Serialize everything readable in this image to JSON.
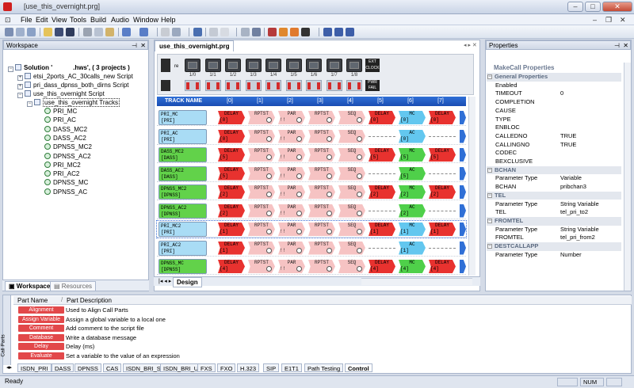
{
  "window": {
    "title": "[use_this_overnight.prg]",
    "controls": [
      "–",
      "□",
      "✕"
    ]
  },
  "menu": [
    "File",
    "Edit",
    "View",
    "Tools",
    "Build",
    "Audio",
    "Window",
    "Help"
  ],
  "workspace": {
    "title": "Workspace",
    "solution": "Solution '",
    "solution_rest": ".hws', ( 3 projects )",
    "projects": [
      "etsi_2ports_AC_30calls_new Script",
      "pri_dass_dpnss_both_dirns Script",
      "use_this_overnight Script"
    ],
    "tracks_node": "use_this_overnight Tracks",
    "tracks": [
      "PRI_MC",
      "PRI_AC",
      "DASS_MC2",
      "DASS_AC2",
      "DPNSS_MC2",
      "DPNSS_AC2",
      "PRI_MC2",
      "PRI_AC2",
      "DPNSS_MC",
      "DPNSS_AC"
    ],
    "tabs": [
      "Workspace",
      "Resources"
    ]
  },
  "editor": {
    "doc_tab": "use_this_overnight.prg",
    "ports": [
      "1/0",
      "1/1",
      "1/2",
      "1/3",
      "1/4",
      "1/5",
      "1/6",
      "1/7",
      "1/8"
    ],
    "re_label": "re",
    "ext_label": "EXT CLOCK",
    "pwr_label": "PWR FAIL",
    "track_header": "TRACK NAME",
    "columns": [
      "[0]",
      "[1]",
      "[2]",
      "[3]",
      "[4]",
      "[5]",
      "[6]",
      "[7]"
    ],
    "rows": [
      {
        "name": "PRI_MC",
        "port": "[PRI]",
        "color": "blue",
        "blocks": [
          [
            "red",
            "DELAY",
            "[0]"
          ],
          [
            "pink",
            "RPTST",
            ""
          ],
          [
            "pink",
            "PAR",
            "!!"
          ],
          [
            "pink",
            "RPTST",
            ""
          ],
          [
            "pink",
            "SEQ",
            ""
          ],
          [
            "red",
            "DELAY",
            "[0]"
          ],
          [
            "cyan",
            "MC",
            "[0]"
          ],
          [
            "red",
            "DELAY",
            "[0]"
          ]
        ]
      },
      {
        "name": "PRI_AC",
        "port": "[PRI]",
        "color": "blue",
        "blocks": [
          [
            "red",
            "DELAY",
            "[0]"
          ],
          [
            "pink",
            "RPTST",
            ""
          ],
          [
            "pink",
            "PAR",
            "!!"
          ],
          [
            "pink",
            "RPTST",
            ""
          ],
          [
            "pink",
            "SEQ",
            ""
          ],
          [
            "dash",
            "",
            ""
          ],
          [
            "cyan",
            "AC",
            "[0]"
          ],
          [
            "dash",
            "",
            ""
          ]
        ]
      },
      {
        "name": "DASS_MC2",
        "port": "[DASS]",
        "color": "green",
        "blocks": [
          [
            "red",
            "DELAY",
            "[5]"
          ],
          [
            "pink",
            "RPTST",
            ""
          ],
          [
            "pink",
            "PAR",
            "!!"
          ],
          [
            "pink",
            "RPTST",
            ""
          ],
          [
            "pink",
            "SEQ",
            ""
          ],
          [
            "red",
            "DELAY",
            "[5]"
          ],
          [
            "green",
            "MC",
            "[5]"
          ],
          [
            "red",
            "DELAY",
            "[5]"
          ]
        ]
      },
      {
        "name": "DASS_AC2",
        "port": "[DASS]",
        "color": "green",
        "blocks": [
          [
            "red",
            "DELAY",
            "[5]"
          ],
          [
            "pink",
            "RPTST",
            ""
          ],
          [
            "pink",
            "PAR",
            "!!"
          ],
          [
            "pink",
            "RPTST",
            ""
          ],
          [
            "pink",
            "SEQ",
            ""
          ],
          [
            "dash",
            "",
            ""
          ],
          [
            "green",
            "AC",
            "[5]"
          ],
          [
            "dash",
            "",
            ""
          ]
        ]
      },
      {
        "name": "DPNSS_MC2",
        "port": "[DPNSS]",
        "color": "green",
        "blocks": [
          [
            "red",
            "DELAY",
            "[2]"
          ],
          [
            "pink",
            "RPTST",
            ""
          ],
          [
            "pink",
            "PAR",
            "!!"
          ],
          [
            "pink",
            "RPTST",
            ""
          ],
          [
            "pink",
            "SEQ",
            ""
          ],
          [
            "red",
            "DELAY",
            "[2]"
          ],
          [
            "green",
            "MC",
            "[2]"
          ],
          [
            "red",
            "DELAY",
            "[2]"
          ]
        ]
      },
      {
        "name": "DPNSS_AC2",
        "port": "[DPNSS]",
        "color": "green",
        "blocks": [
          [
            "red",
            "DELAY",
            "[2]"
          ],
          [
            "pink",
            "RPTST",
            ""
          ],
          [
            "pink",
            "PAR",
            "!!"
          ],
          [
            "pink",
            "RPTST",
            ""
          ],
          [
            "pink",
            "SEQ",
            ""
          ],
          [
            "dash",
            "",
            ""
          ],
          [
            "green",
            "AC",
            "[2]"
          ],
          [
            "dash",
            "",
            ""
          ]
        ]
      },
      {
        "name": "PRI_MC2",
        "port": "[PRI]",
        "color": "blue",
        "blocks": [
          [
            "red",
            "DELAY",
            "[1]"
          ],
          [
            "pink",
            "RPTST",
            ""
          ],
          [
            "pink",
            "PAR",
            "!!"
          ],
          [
            "pink",
            "RPTST",
            ""
          ],
          [
            "pink",
            "SEQ",
            ""
          ],
          [
            "red",
            "DELAY",
            "[1]"
          ],
          [
            "cyan",
            "MC",
            "[1]"
          ],
          [
            "red",
            "DELAY",
            "[1]"
          ]
        ]
      },
      {
        "name": "PRI_AC2",
        "port": "[PRI]",
        "color": "blue",
        "blocks": [
          [
            "red",
            "DELAY",
            "[1]"
          ],
          [
            "pink",
            "RPTST",
            ""
          ],
          [
            "pink",
            "PAR",
            "!!"
          ],
          [
            "pink",
            "RPTST",
            ""
          ],
          [
            "pink",
            "SEQ",
            ""
          ],
          [
            "dash",
            "",
            ""
          ],
          [
            "cyan",
            "AC",
            "[1]"
          ],
          [
            "dash",
            "",
            ""
          ]
        ]
      },
      {
        "name": "DPNSS_MC",
        "port": "[DPNSS]",
        "color": "green",
        "blocks": [
          [
            "red",
            "DELAY",
            "[4]"
          ],
          [
            "pink",
            "RPTST",
            ""
          ],
          [
            "pink",
            "PAR",
            "!!"
          ],
          [
            "pink",
            "RPTST",
            ""
          ],
          [
            "pink",
            "SEQ",
            ""
          ],
          [
            "red",
            "DELAY",
            "[4]"
          ],
          [
            "green",
            "MC",
            "[4]"
          ],
          [
            "red",
            "DELAY",
            "[4]"
          ]
        ]
      }
    ],
    "tabs": [
      "Design"
    ]
  },
  "properties": {
    "title": "Properties",
    "subtitle": "MakeCall Properties",
    "rows": [
      {
        "cat": true,
        "k": "General Properties"
      },
      {
        "k": "Enabled",
        "v": ""
      },
      {
        "k": "TIMEOUT",
        "v": "0"
      },
      {
        "k": "COMPLETION",
        "v": ""
      },
      {
        "k": "CAUSE",
        "v": ""
      },
      {
        "k": "TYPE",
        "v": ""
      },
      {
        "k": "ENBLOC",
        "v": ""
      },
      {
        "k": "CALLEDNO",
        "v": "TRUE"
      },
      {
        "k": "CALLINGNO",
        "v": "TRUE"
      },
      {
        "k": "CODEC",
        "v": ""
      },
      {
        "k": "BEXCLUSIVE",
        "v": ""
      },
      {
        "cat": true,
        "k": "BCHAN"
      },
      {
        "k": "Parameter Type",
        "v": "Variable"
      },
      {
        "k": "BCHAN",
        "v": "pribchan3"
      },
      {
        "cat": true,
        "k": "TEL"
      },
      {
        "k": "Parameter Type",
        "v": "String Variable"
      },
      {
        "k": "TEL",
        "v": "tel_pri_to2"
      },
      {
        "cat": true,
        "k": "FROMTEL"
      },
      {
        "k": "Parameter Type",
        "v": "String Variable"
      },
      {
        "k": "FROMTEL",
        "v": "tel_pri_from2"
      },
      {
        "cat": true,
        "k": "DESTCALLAPP"
      },
      {
        "k": "Parameter Type",
        "v": "Number"
      }
    ]
  },
  "callparts": {
    "side_label": "Call Parts",
    "col_name": "Part Name",
    "col_desc": "Part Description",
    "rows": [
      {
        "name": "Alignment",
        "desc": "Used to Align Call Parts"
      },
      {
        "name": "Assign Variable",
        "desc": "Assign a global variable to a local one"
      },
      {
        "name": "Comment",
        "desc": "Add comment to the script file"
      },
      {
        "name": "Database",
        "desc": "Write a database message"
      },
      {
        "name": "Delay",
        "desc": "Delay (ms)"
      },
      {
        "name": "Evaluate",
        "desc": "Set a variable to the value of an expression"
      }
    ],
    "tabs": [
      "ISDN_PRI",
      "DASS",
      "DPNSS",
      "CAS",
      "ISDN_BRI_S",
      "ISDN_BRI_U",
      "FXS",
      "FXO",
      "H.323",
      "SIP",
      "E1T1",
      "Path Testing",
      "Control"
    ]
  },
  "status": {
    "ready": "Ready",
    "num": "NUM"
  }
}
